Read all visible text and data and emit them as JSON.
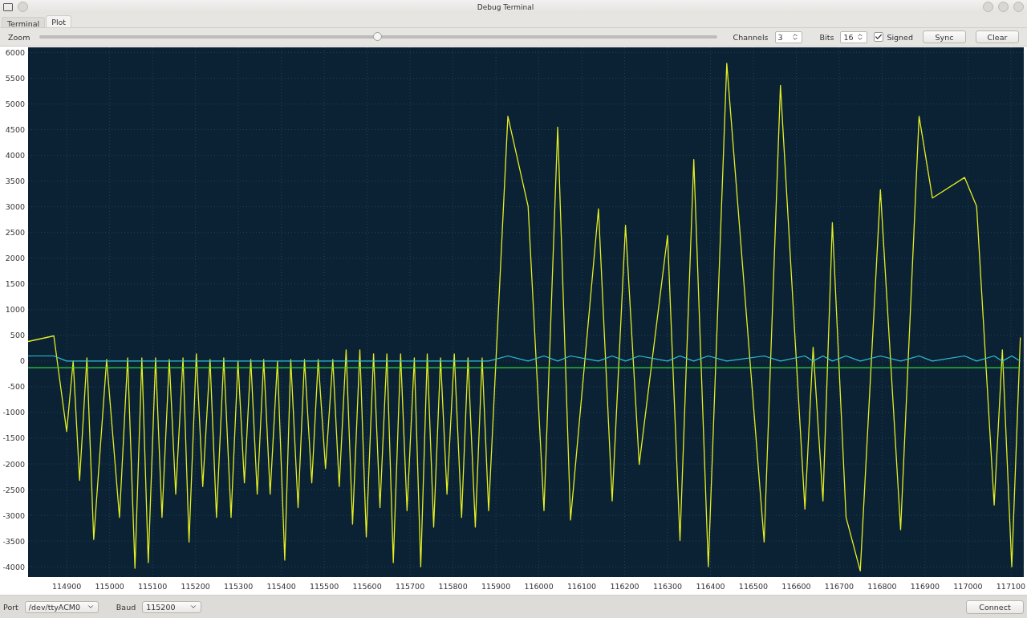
{
  "window": {
    "title": "Debug Terminal"
  },
  "tabs": [
    {
      "label": "Terminal",
      "selected": false
    },
    {
      "label": "Plot",
      "selected": true
    }
  ],
  "toolbar": {
    "zoom": {
      "label": "Zoom",
      "level": 0.5
    },
    "channels": {
      "label": "Channels",
      "value": "3"
    },
    "bits": {
      "label": "Bits",
      "value": "16"
    },
    "signed": {
      "label": "Signed",
      "checked": true
    },
    "buttons": [
      "Sync",
      "Clear"
    ]
  },
  "plot": {
    "chart_data": {
      "type": "line",
      "grid": true,
      "xlim": [
        114810,
        117130
      ],
      "ylim": [
        -4200,
        6100
      ],
      "xticks": [
        114900,
        115000,
        115100,
        115200,
        115300,
        115400,
        115500,
        115600,
        115700,
        115800,
        115900,
        116000,
        116100,
        116200,
        116300,
        116400,
        116500,
        116600,
        116700,
        116800,
        116900,
        117000,
        117100
      ],
      "yticks": [
        -4000,
        -3500,
        -3000,
        -2500,
        -2000,
        -1500,
        -1000,
        -500,
        0,
        500,
        1000,
        1500,
        2000,
        2500,
        3000,
        3500,
        4000,
        4500,
        5000,
        5500,
        6000
      ],
      "x": [
        114810,
        114870,
        114900,
        114915,
        114930,
        114947,
        114963,
        114993,
        115023,
        115042,
        115059,
        115075,
        115090,
        115107,
        115122,
        115139,
        115154,
        115171,
        115185,
        115202,
        115217,
        115234,
        115249,
        115266,
        115283,
        115299,
        115314,
        115329,
        115344,
        115359,
        115374,
        115391,
        115408,
        115422,
        115439,
        115454,
        115471,
        115486,
        115503,
        115520,
        115535,
        115551,
        115566,
        115583,
        115598,
        115615,
        115630,
        115646,
        115661,
        115678,
        115693,
        115710,
        115725,
        115740,
        115755,
        115771,
        115786,
        115803,
        115820,
        115835,
        115852,
        115868,
        115883,
        115928,
        115975,
        116012,
        116044,
        116074,
        116139,
        116171,
        116202,
        116234,
        116300,
        116329,
        116361,
        116395,
        116438,
        116525,
        116563,
        116620,
        116639,
        116662,
        116684,
        116716,
        116749,
        116796,
        116843,
        116886,
        116917,
        116992,
        117020,
        117061,
        117080,
        117102,
        117122
      ],
      "series": [
        {
          "color": "#e4ee22",
          "values": [
            380,
            490,
            -1370,
            0,
            -2320,
            60,
            -3470,
            30,
            -3040,
            60,
            -4030,
            60,
            -3920,
            60,
            -3040,
            30,
            -2590,
            60,
            -3520,
            140,
            -2440,
            30,
            -3040,
            60,
            -3040,
            0,
            -2370,
            30,
            -2590,
            30,
            -2590,
            0,
            -3870,
            30,
            -2850,
            30,
            -2370,
            30,
            -2090,
            30,
            -2440,
            220,
            -3170,
            220,
            -3420,
            140,
            -2850,
            140,
            -3920,
            140,
            -2910,
            60,
            -4000,
            140,
            -3230,
            60,
            -2590,
            140,
            -3040,
            60,
            -3230,
            60,
            -2910,
            4760,
            3010,
            -2910,
            4550,
            -3090,
            2960,
            -2720,
            2640,
            -2010,
            2440,
            -3490,
            3920,
            -4000,
            5790,
            -3520,
            5360,
            -2880,
            270,
            -2720,
            2690,
            -3040,
            -4080,
            3330,
            -3280,
            4760,
            3170,
            3570,
            3010,
            -2800,
            220,
            -4000,
            460
          ]
        },
        {
          "color": "#2fc3d3",
          "values": [
            100,
            100,
            0,
            0,
            0,
            0,
            0,
            0,
            0,
            0,
            0,
            0,
            0,
            0,
            0,
            0,
            0,
            0,
            0,
            0,
            0,
            0,
            0,
            0,
            0,
            0,
            0,
            0,
            0,
            0,
            0,
            0,
            0,
            0,
            0,
            0,
            0,
            0,
            0,
            0,
            0,
            0,
            0,
            0,
            0,
            0,
            0,
            0,
            0,
            0,
            0,
            0,
            0,
            0,
            0,
            0,
            0,
            0,
            0,
            0,
            0,
            0,
            0,
            100,
            0,
            100,
            0,
            100,
            0,
            100,
            0,
            100,
            0,
            100,
            0,
            100,
            0,
            100,
            0,
            100,
            0,
            100,
            0,
            100,
            0,
            100,
            0,
            100,
            0,
            100,
            0,
            100,
            0,
            100,
            0
          ]
        },
        {
          "color": "#34d23a",
          "values": [
            -130,
            -130,
            -130,
            -130,
            -130,
            -130,
            -130,
            -130,
            -130,
            -130,
            -130,
            -130,
            -130,
            -130,
            -130,
            -130,
            -130,
            -130,
            -130,
            -130,
            -130,
            -130,
            -130,
            -130,
            -130,
            -130,
            -130,
            -130,
            -130,
            -130,
            -130,
            -130,
            -130,
            -130,
            -130,
            -130,
            -130,
            -130,
            -130,
            -130,
            -130,
            -130,
            -130,
            -130,
            -130,
            -130,
            -130,
            -130,
            -130,
            -130,
            -130,
            -130,
            -130,
            -130,
            -130,
            -130,
            -130,
            -130,
            -130,
            -130,
            -130,
            -130,
            -130,
            -130,
            -130,
            -130,
            -130,
            -130,
            -130,
            -130,
            -130,
            -130,
            -130,
            -130,
            -130,
            -130,
            -130,
            -130,
            -130,
            -130,
            -130,
            -130,
            -130,
            -130,
            -130,
            -130,
            -130,
            -130,
            -130,
            -130,
            -130,
            -130,
            -130,
            -130,
            -130
          ]
        }
      ]
    }
  },
  "bottom_bar": {
    "port": {
      "label": "Port",
      "value": "/dev/ttyACM0"
    },
    "baud": {
      "label": "Baud",
      "value": "115200"
    },
    "connect": "Connect"
  }
}
